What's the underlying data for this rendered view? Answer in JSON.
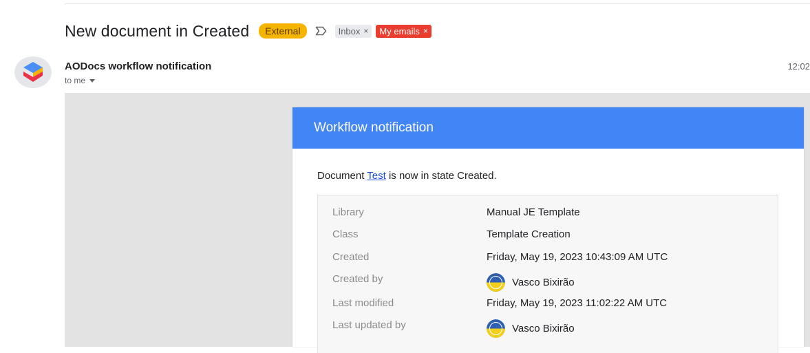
{
  "subject": {
    "title": "New document in Created",
    "badge": "External",
    "labels": [
      {
        "text": "Inbox",
        "remove": "×"
      },
      {
        "text": "My emails",
        "remove": "×"
      }
    ]
  },
  "message": {
    "sender": "AODocs workflow notification",
    "recipient": "to me",
    "time": "12:02"
  },
  "card": {
    "header": "Workflow notification",
    "intro_prefix": "Document ",
    "doc_link": "Test",
    "intro_suffix": " is now in state Created.",
    "rows": [
      {
        "label": "Library",
        "value": "Manual JE Template"
      },
      {
        "label": "Class",
        "value": "Template Creation"
      },
      {
        "label": "Created",
        "value": "Friday, May 19, 2023 10:43:09 AM UTC"
      },
      {
        "label": "Created by",
        "value": "Vasco Bixirão"
      },
      {
        "label": "Last modified",
        "value": "Friday, May 19, 2023 11:02:22 AM UTC"
      },
      {
        "label": "Last updated by",
        "value": "Vasco Bixirão"
      }
    ]
  },
  "icons": {
    "important": "important-arrow-icon",
    "caret": "caret-down-icon",
    "logo": "aodocs-logo-icon"
  },
  "colors": {
    "header_blue": "#4285f4",
    "external_badge": "#f5b400",
    "my_emails_chip": "#ea3d2f",
    "link": "#1a4fd6"
  }
}
